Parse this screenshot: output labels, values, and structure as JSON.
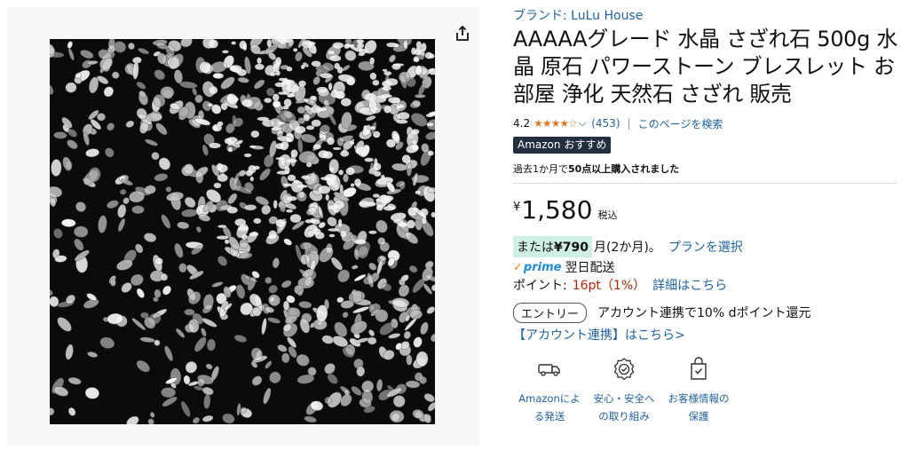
{
  "brand": "ブランド: LuLu House",
  "title": "AAAAAグレード 水晶 さざれ石 500g 水晶 原石 パワーストーン ブレスレット お部屋 浄化 天然石 さざれ 販売",
  "rating": {
    "value": "4.2",
    "stars": "★★★★☆",
    "count": "(453)",
    "separator": "|",
    "search_link": "このページを検索"
  },
  "badge": "Amazon おすすめ",
  "bought": {
    "prefix": "過去1か月で",
    "bold": "50点以上購入されました"
  },
  "price": {
    "symbol": "¥",
    "whole": "1,580",
    "tax": "税込"
  },
  "installment": {
    "prefix": "または",
    "amount": "¥790",
    "suffix": "月(2か月)。",
    "link": "プランを選択"
  },
  "prime": {
    "check": "✓",
    "logo": "prime",
    "delivery": "翌日配送"
  },
  "points": {
    "label": "ポイント:",
    "value": "16pt（1%）",
    "link": "詳細はこちら"
  },
  "entry": {
    "button": "エントリー",
    "text": "アカウント連携で10% dポイント還元"
  },
  "account_link": "【アカウント連携】はこちら>",
  "features": [
    {
      "icon": "truck-icon",
      "line1": "Amazonによ",
      "line2": "る発送"
    },
    {
      "icon": "shield-check-icon",
      "line1": "安心・安全へ",
      "line2": "の取り組み"
    },
    {
      "icon": "lock-bag-icon",
      "line1": "お客様情報の",
      "line2": "保護"
    }
  ],
  "colors": {
    "link": "#2162a1",
    "star": "#de7921",
    "price_red": "#b12704",
    "badge_bg": "#232f3e",
    "install_bg": "#cfeee4"
  }
}
